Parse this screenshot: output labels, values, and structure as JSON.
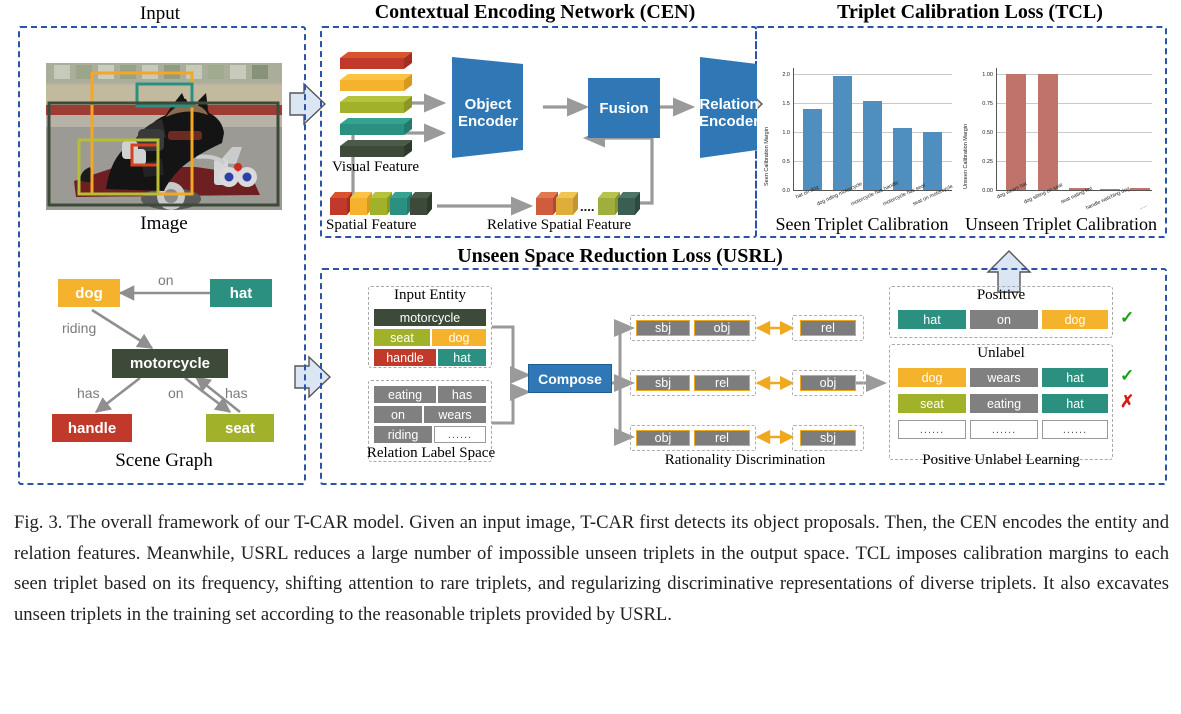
{
  "figure": {
    "panels": {
      "input_title": "Input",
      "cen_title": "Contextual Encoding Network (CEN)",
      "tcl_title": "Triplet Calibration Loss (TCL)",
      "usrl_title": "Unseen Space Reduction Loss (USRL)"
    },
    "input": {
      "image_label": "Image",
      "scene_graph_label": "Scene Graph",
      "boxes": [
        {
          "name": "dog-box",
          "color": "#f5a623"
        },
        {
          "name": "hat-box",
          "color": "#2b9080"
        },
        {
          "name": "motorcycle-box",
          "color": "#3d4a3a"
        },
        {
          "name": "handle-box",
          "color": "#d8411f"
        },
        {
          "name": "seat-box",
          "color": "#a2b12a"
        }
      ]
    },
    "scene_graph": {
      "nodes": [
        {
          "id": "dog",
          "label": "dog",
          "color": "#f5b22d"
        },
        {
          "id": "hat",
          "label": "hat",
          "color": "#2b9080"
        },
        {
          "id": "motorcycle",
          "label": "motorcycle",
          "color": "#3d4a3a"
        },
        {
          "id": "handle",
          "label": "handle",
          "color": "#c0392b"
        },
        {
          "id": "seat",
          "label": "seat",
          "color": "#a2b12a"
        }
      ],
      "edges": [
        {
          "from": "hat",
          "to": "dog",
          "label": "on"
        },
        {
          "from": "dog",
          "to": "motorcycle",
          "label": "riding"
        },
        {
          "from": "motorcycle",
          "to": "handle",
          "label": "has"
        },
        {
          "from": "motorcycle",
          "to": "seat",
          "label": "has"
        },
        {
          "from": "seat",
          "to": "motorcycle",
          "label": "on"
        }
      ]
    },
    "cen": {
      "visual_feature_label": "Visual Feature",
      "spatial_feature_label": "Spatial Feature",
      "relative_spatial_feature_label": "Relative Spatial Feature",
      "object_encoder_label": "Object\nEncoder",
      "object_encoder_line1": "Object",
      "object_encoder_line2": "Encoder",
      "fusion_label": "Fusion",
      "relation_encoder_line1": "Relation",
      "relation_encoder_line2": "Encoder",
      "feature_colors": [
        "#c0392b",
        "#f5b22d",
        "#a2b12a",
        "#2b9080",
        "#3d4a3a"
      ],
      "block_color": "#2f77b5"
    },
    "tcl": {
      "seen_caption": "Seen Triplet Calibration",
      "unseen_caption": "Unseen Triplet Calibration"
    },
    "usrl": {
      "input_entity_title": "Input Entity",
      "relation_label_space_title": "Relation Label Space",
      "rationality_title": "Rationality Discrimination",
      "pu_title": "Positive Unlabel Learning",
      "compose_label": "Compose",
      "entities": [
        {
          "label": "motorcycle",
          "color": "#3d4a3a"
        },
        {
          "label": "seat",
          "color": "#a2b12a"
        },
        {
          "label": "dog",
          "color": "#f5b22d"
        },
        {
          "label": "handle",
          "color": "#c0392b"
        },
        {
          "label": "hat",
          "color": "#2b9080"
        }
      ],
      "relations": [
        "eating",
        "has",
        "on",
        "wears",
        "riding",
        "......"
      ],
      "triplet_patterns": [
        {
          "left": [
            "sbj",
            "obj"
          ],
          "right": [
            "rel"
          ]
        },
        {
          "left": [
            "sbj",
            "rel"
          ],
          "right": [
            "obj"
          ]
        },
        {
          "left": [
            "obj",
            "rel"
          ],
          "right": [
            "sbj"
          ]
        }
      ],
      "positive_title": "Positive",
      "unlabel_title": "Unlabel",
      "positive_rows": [
        {
          "sbj": "hat",
          "sbj_color": "#2b9080",
          "rel": "on",
          "obj": "dog",
          "obj_color": "#f5b22d",
          "mark": "✓",
          "mark_color": "#1aa01a"
        }
      ],
      "unlabel_rows": [
        {
          "sbj": "dog",
          "sbj_color": "#f5b22d",
          "rel": "wears",
          "obj": "hat",
          "obj_color": "#2b9080",
          "mark": "✓",
          "mark_color": "#1aa01a"
        },
        {
          "sbj": "seat",
          "sbj_color": "#a2b12a",
          "rel": "eating",
          "obj": "hat",
          "obj_color": "#2b9080",
          "mark": "✗",
          "mark_color": "#d0201a"
        },
        {
          "sbj": "......",
          "sbj_color": "#ffffff",
          "rel": "......",
          "obj": "......",
          "obj_color": "#ffffff",
          "mark": "",
          "mark_color": "#ffffff"
        }
      ]
    },
    "caption": "Fig. 3. The overall framework of our T-CAR model. Given an input image, T-CAR first detects its object proposals. Then, the CEN encodes the entity and relation features. Meanwhile, USRL reduces a large number of impossible unseen triplets in the output space. TCL imposes calibration margins to each seen triplet based on its frequency, shifting attention to rare triplets, and regularizing discriminative representations of diverse triplets. It also excavates unseen triplets in the training set according to the reasonable triplets provided by USRL."
  },
  "chart_data": [
    {
      "type": "bar",
      "title": "Seen Triplet Calibration",
      "ylabel": "Seen Calibration Margin",
      "xlabel": "",
      "categories": [
        "hat on dog",
        "dog riding motorcycle",
        "motorcycle has handle",
        "motorcycle has seat",
        "seat on motorcycle"
      ],
      "values": [
        1.4,
        1.97,
        1.54,
        1.07,
        1.0
      ],
      "ylim": [
        0.0,
        2.15
      ],
      "yticks": [
        "0.0",
        "0.5",
        "1.0",
        "1.5",
        "2.0"
      ],
      "ytick_values": [
        0.0,
        0.5,
        1.0,
        1.5,
        2.0
      ],
      "color": "#4f8fc0",
      "grid": true,
      "legend": "none"
    },
    {
      "type": "bar",
      "title": "Unseen Triplet Calibration",
      "ylabel": "Unseen Calibration Margin",
      "xlabel": "",
      "categories": [
        "dog wears hat",
        "dog sitting on seat",
        "seat eating hat",
        "handle watching dog",
        "......"
      ],
      "values": [
        1.0,
        1.0,
        0.012,
        0.01,
        0.012
      ],
      "ylim": [
        0.0,
        1.08
      ],
      "yticks": [
        "0.00",
        "0.25",
        "0.50",
        "0.75",
        "1.00"
      ],
      "ytick_values": [
        0.0,
        0.25,
        0.5,
        0.75,
        1.0
      ],
      "color": "#c0736b",
      "grid": true,
      "legend": "none"
    }
  ]
}
